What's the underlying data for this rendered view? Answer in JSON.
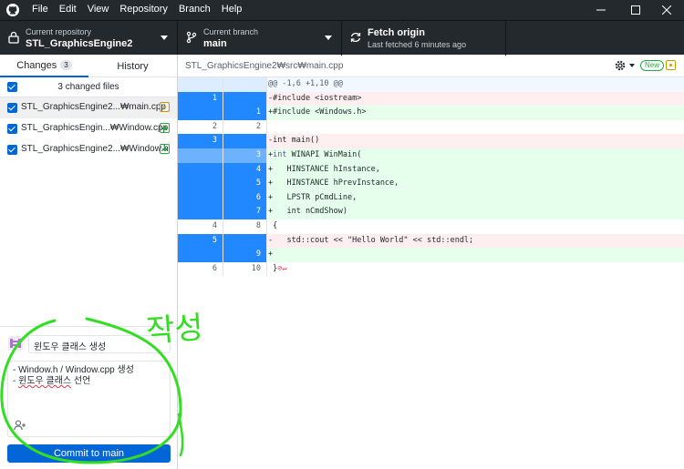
{
  "window": {
    "menu": [
      "File",
      "Edit",
      "View",
      "Repository",
      "Branch",
      "Help"
    ]
  },
  "toolbar": {
    "repo": {
      "sub": "Current repository",
      "main": "STL_GraphicsEngine2"
    },
    "branch": {
      "sub": "Current branch",
      "main": "main"
    },
    "fetch": {
      "main": "Fetch origin",
      "sub": "Last fetched 6 minutes ago"
    }
  },
  "sidebar": {
    "tabs": [
      {
        "label": "Changes",
        "count": "3"
      },
      {
        "label": "History"
      }
    ],
    "changed_files_label": "3 changed files",
    "files": [
      {
        "name": "STL_GraphicsEngine2...₩main.cpp",
        "status": "modified"
      },
      {
        "name": "STL_GraphicsEngin...₩Window.cpp",
        "status": "added"
      },
      {
        "name": "STL_GraphicsEngine2...₩Window.h",
        "status": "added"
      }
    ]
  },
  "commit": {
    "summary_value": "윈도우 클래스 생성",
    "description_lines": [
      "- Window.h / Window.cpp 생성",
      "- 윈도우 클래스 선언"
    ],
    "description_underlined": "윈도우 클래스",
    "button_label": "Commit to main"
  },
  "diff": {
    "path": "STL_GraphicsEngine2₩src₩main.cpp",
    "new_badge": "New",
    "rows": [
      {
        "type": "hunk",
        "old": "",
        "new": "",
        "code": "@@ -1,6 +1,10 @@"
      },
      {
        "type": "del",
        "old": "1",
        "new": "",
        "code": "-#include <iostream>",
        "sel": true
      },
      {
        "type": "add",
        "old": "",
        "new": "1",
        "code": "+#include <Windows.h>",
        "sel": true
      },
      {
        "type": "ctx",
        "old": "2",
        "new": "2",
        "code": " "
      },
      {
        "type": "del",
        "old": "3",
        "new": "",
        "code": "-int main()",
        "sel": true
      },
      {
        "type": "add",
        "old": "",
        "new": "3",
        "code": "+int WINAPI WinMain(",
        "sel": true,
        "light": true
      },
      {
        "type": "add",
        "old": "",
        "new": "4",
        "code": "+   HINSTANCE hInstance,",
        "sel": true
      },
      {
        "type": "add",
        "old": "",
        "new": "5",
        "code": "+   HINSTANCE hPrevInstance,",
        "sel": true
      },
      {
        "type": "add",
        "old": "",
        "new": "6",
        "code": "+   LPSTR pCmdLine,",
        "sel": true
      },
      {
        "type": "add",
        "old": "",
        "new": "7",
        "code": "+   int nCmdShow)",
        "sel": true
      },
      {
        "type": "ctx",
        "old": "4",
        "new": "8",
        "code": " {"
      },
      {
        "type": "del",
        "old": "5",
        "new": "",
        "code": "-   std::cout << \"Hello World\" << std::endl;",
        "sel": true
      },
      {
        "type": "add",
        "old": "",
        "new": "9",
        "code": "+",
        "sel": true
      },
      {
        "type": "ctx",
        "old": "6",
        "new": "10",
        "code": " }",
        "eol": "⊘↵"
      }
    ]
  },
  "annotation": {
    "text": "작성",
    "color": "#33dd22"
  },
  "icons": {
    "app": "github-icon",
    "repo": "repository-icon",
    "branch": "branch-icon",
    "fetch": "sync-icon",
    "settings": "gear-icon",
    "coauthor": "add-coauthor-icon"
  }
}
